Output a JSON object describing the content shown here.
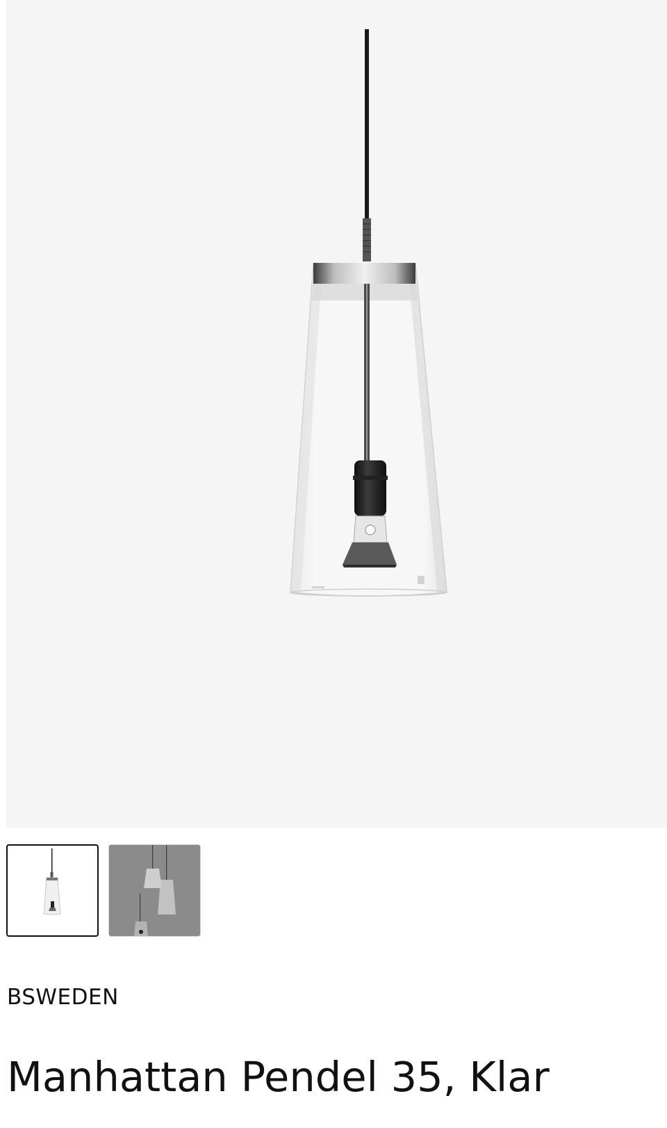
{
  "product": {
    "brand": "BSWEDEN",
    "title": "Manhattan Pendel 35, Klar"
  },
  "gallery": {
    "main_image": "pendant-lamp-clear-glass",
    "thumbnails": [
      {
        "name": "pendant-lamp-single-view",
        "selected": true
      },
      {
        "name": "pendant-lamps-group-view",
        "selected": false
      }
    ]
  },
  "colors": {
    "text": "#111111",
    "hero_background": "#f5f5f5",
    "thumb_active_border": "#111111"
  }
}
